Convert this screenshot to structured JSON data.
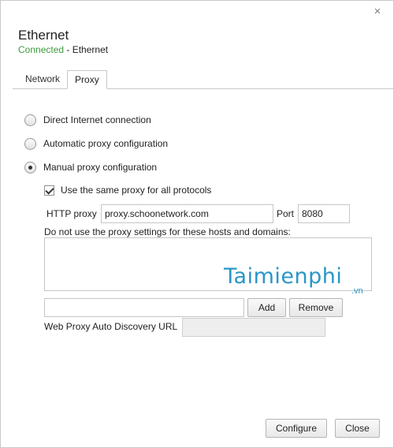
{
  "header": {
    "title": "Ethernet",
    "status": "Connected",
    "status_suffix": " - Ethernet",
    "close_glyph": "×"
  },
  "tabs": [
    {
      "label": "Network",
      "active": false
    },
    {
      "label": "Proxy",
      "active": true
    }
  ],
  "proxy_mode": {
    "options": [
      {
        "label": "Direct Internet connection",
        "checked": false
      },
      {
        "label": "Automatic proxy configuration",
        "checked": false
      },
      {
        "label": "Manual proxy configuration",
        "checked": true
      }
    ]
  },
  "manual": {
    "same_proxy_label": "Use the same proxy for all protocols",
    "same_proxy_checked": true,
    "http_proxy_label": "HTTP proxy",
    "http_proxy_value": "proxy.schoonetwork.com",
    "port_label": "Port",
    "port_value": "8080",
    "bypass_label": "Do not use the proxy settings for these hosts and domains:",
    "bypass_entry_value": "",
    "add_label": "Add",
    "remove_label": "Remove",
    "wpad_label": "Web Proxy Auto Discovery URL",
    "wpad_value": ""
  },
  "footer": {
    "configure_label": "Configure",
    "close_label": "Close"
  },
  "watermark": {
    "text": "Taimienphi",
    "sub": ".vn"
  },
  "colors": {
    "status_green": "#3c9b3c",
    "watermark_blue": "#2a96c6"
  }
}
